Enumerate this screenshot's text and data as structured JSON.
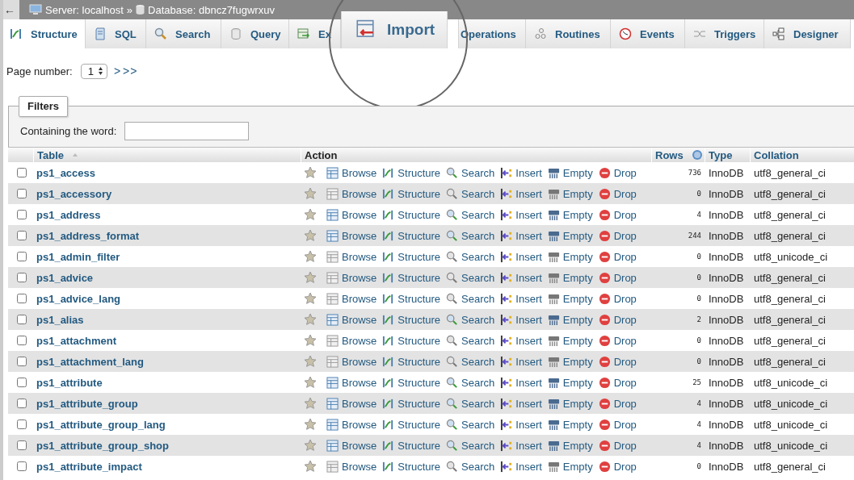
{
  "breadcrumb": {
    "back": "←",
    "server": "Server: localhost",
    "separator": "»",
    "database": "Database: dbncz7fugwrxuv"
  },
  "tabs": [
    {
      "label": "Structure",
      "selected": true,
      "magnified": false
    },
    {
      "label": "SQL",
      "selected": false,
      "magnified": false
    },
    {
      "label": "Search",
      "selected": false,
      "magnified": false
    },
    {
      "label": "Query",
      "selected": false,
      "magnified": false
    },
    {
      "label": "Ex",
      "selected": false,
      "magnified": false
    },
    {
      "label": "Import",
      "selected": false,
      "magnified": true
    },
    {
      "label": "Operations",
      "selected": false,
      "magnified": false
    },
    {
      "label": "Routines",
      "selected": false,
      "magnified": false
    },
    {
      "label": "Events",
      "selected": false,
      "magnified": false
    },
    {
      "label": "Triggers",
      "selected": false,
      "magnified": false
    },
    {
      "label": "Designer",
      "selected": false,
      "magnified": false
    }
  ],
  "pagination": {
    "label": "Page number:",
    "value": "1",
    "links": [
      ">",
      ">>"
    ]
  },
  "filters": {
    "legend": "Filters",
    "label": "Containing the word:"
  },
  "table": {
    "columns": [
      "Table",
      "Action",
      "Rows",
      "Type",
      "Collation"
    ],
    "rows": [
      {
        "name": "ps1_access",
        "checked": false,
        "has_data": true,
        "actions": [
          "Browse",
          "Structure",
          "Search",
          "Insert",
          "Empty",
          "Drop"
        ],
        "rows": "736",
        "type": "InnoDB",
        "collation": "utf8_general_ci"
      },
      {
        "name": "ps1_accessory",
        "checked": false,
        "has_data": false,
        "actions": [
          "Browse",
          "Structure",
          "Search",
          "Insert",
          "Empty",
          "Drop"
        ],
        "rows": "0",
        "type": "InnoDB",
        "collation": "utf8_general_ci"
      },
      {
        "name": "ps1_address",
        "checked": false,
        "has_data": true,
        "actions": [
          "Browse",
          "Structure",
          "Search",
          "Insert",
          "Empty",
          "Drop"
        ],
        "rows": "4",
        "type": "InnoDB",
        "collation": "utf8_general_ci"
      },
      {
        "name": "ps1_address_format",
        "checked": false,
        "has_data": true,
        "actions": [
          "Browse",
          "Structure",
          "Search",
          "Insert",
          "Empty",
          "Drop"
        ],
        "rows": "244",
        "type": "InnoDB",
        "collation": "utf8_general_ci"
      },
      {
        "name": "ps1_admin_filter",
        "checked": false,
        "has_data": false,
        "actions": [
          "Browse",
          "Structure",
          "Search",
          "Insert",
          "Empty",
          "Drop"
        ],
        "rows": "0",
        "type": "InnoDB",
        "collation": "utf8_unicode_ci"
      },
      {
        "name": "ps1_advice",
        "checked": false,
        "has_data": false,
        "actions": [
          "Browse",
          "Structure",
          "Search",
          "Insert",
          "Empty",
          "Drop"
        ],
        "rows": "0",
        "type": "InnoDB",
        "collation": "utf8_general_ci"
      },
      {
        "name": "ps1_advice_lang",
        "checked": false,
        "has_data": false,
        "actions": [
          "Browse",
          "Structure",
          "Search",
          "Insert",
          "Empty",
          "Drop"
        ],
        "rows": "0",
        "type": "InnoDB",
        "collation": "utf8_general_ci"
      },
      {
        "name": "ps1_alias",
        "checked": false,
        "has_data": true,
        "actions": [
          "Browse",
          "Structure",
          "Search",
          "Insert",
          "Empty",
          "Drop"
        ],
        "rows": "2",
        "type": "InnoDB",
        "collation": "utf8_general_ci"
      },
      {
        "name": "ps1_attachment",
        "checked": false,
        "has_data": false,
        "actions": [
          "Browse",
          "Structure",
          "Search",
          "Insert",
          "Empty",
          "Drop"
        ],
        "rows": "0",
        "type": "InnoDB",
        "collation": "utf8_general_ci"
      },
      {
        "name": "ps1_attachment_lang",
        "checked": false,
        "has_data": false,
        "actions": [
          "Browse",
          "Structure",
          "Search",
          "Insert",
          "Empty",
          "Drop"
        ],
        "rows": "0",
        "type": "InnoDB",
        "collation": "utf8_general_ci"
      },
      {
        "name": "ps1_attribute",
        "checked": false,
        "has_data": true,
        "actions": [
          "Browse",
          "Structure",
          "Search",
          "Insert",
          "Empty",
          "Drop"
        ],
        "rows": "25",
        "type": "InnoDB",
        "collation": "utf8_unicode_ci"
      },
      {
        "name": "ps1_attribute_group",
        "checked": false,
        "has_data": true,
        "actions": [
          "Browse",
          "Structure",
          "Search",
          "Insert",
          "Empty",
          "Drop"
        ],
        "rows": "4",
        "type": "InnoDB",
        "collation": "utf8_unicode_ci"
      },
      {
        "name": "ps1_attribute_group_lang",
        "checked": false,
        "has_data": true,
        "actions": [
          "Browse",
          "Structure",
          "Search",
          "Insert",
          "Empty",
          "Drop"
        ],
        "rows": "4",
        "type": "InnoDB",
        "collation": "utf8_unicode_ci"
      },
      {
        "name": "ps1_attribute_group_shop",
        "checked": false,
        "has_data": true,
        "actions": [
          "Browse",
          "Structure",
          "Search",
          "Insert",
          "Empty",
          "Drop"
        ],
        "rows": "4",
        "type": "InnoDB",
        "collation": "utf8_unicode_ci"
      },
      {
        "name": "ps1_attribute_impact",
        "checked": false,
        "has_data": false,
        "actions": [
          "Browse",
          "Structure",
          "Search",
          "Insert",
          "Empty",
          "Drop"
        ],
        "rows": "0",
        "type": "InnoDB",
        "collation": "utf8_general_ci"
      }
    ]
  }
}
